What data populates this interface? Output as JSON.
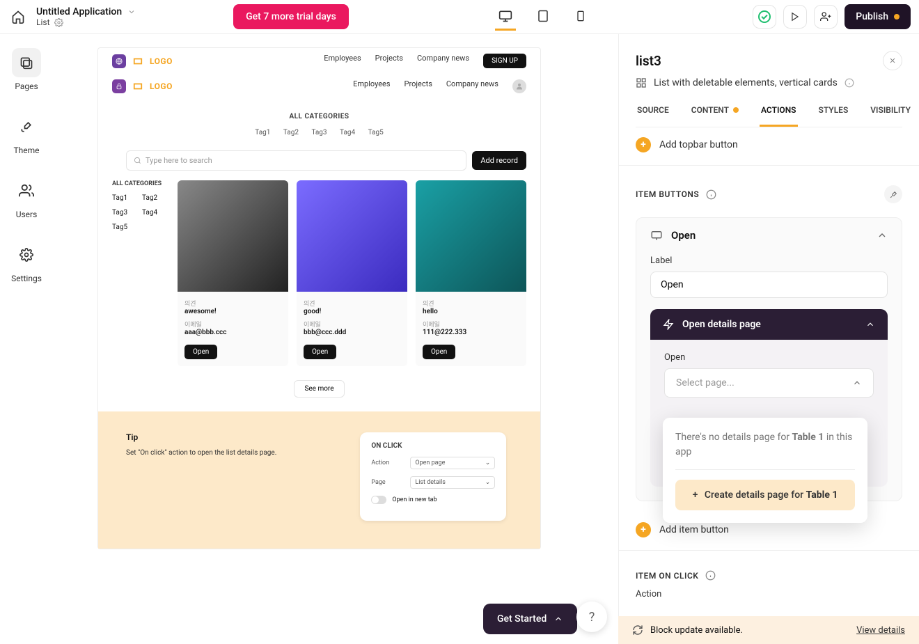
{
  "topbar": {
    "app_title": "Untitled Application",
    "page_label": "List",
    "trial_btn": "Get 7 more trial days",
    "publish_btn": "Publish"
  },
  "leftrail": {
    "pages": "Pages",
    "theme": "Theme",
    "users": "Users",
    "settings": "Settings"
  },
  "canvas": {
    "logo": "LOGO",
    "nav": {
      "employees": "Employees",
      "projects": "Projects",
      "news": "Company news",
      "signup": "SIGN UP"
    },
    "allcat": "ALL CATEGORIES",
    "tags": {
      "t1": "Tag1",
      "t2": "Tag2",
      "t3": "Tag3",
      "t4": "Tag4",
      "t5": "Tag5"
    },
    "search_ph": "Type here to search",
    "addrec": "Add record",
    "side_allcat": "ALL CATEGORIES",
    "cards": [
      {
        "l1": "의견",
        "v1": "awesome!",
        "l2": "이메일",
        "v2": "aaa@bbb.ccc",
        "open": "Open"
      },
      {
        "l1": "의견",
        "v1": "good!",
        "l2": "이메일",
        "v2": "bbb@ccc.ddd",
        "open": "Open"
      },
      {
        "l1": "의견",
        "v1": "hello",
        "l2": "이메일",
        "v2": "111@222.333",
        "open": "Open"
      }
    ],
    "seemore": "See more",
    "tip": {
      "title": "Tip",
      "desc": "Set \"On click\" action to open the list details page.",
      "panel_title": "ON CLICK",
      "row_action": "Action",
      "row_action_val": "Open page",
      "row_page": "Page",
      "row_page_val": "List details",
      "row_newtab": "Open in new tab"
    }
  },
  "panel": {
    "title": "list3",
    "subtitle": "List with deletable elements, vertical cards",
    "tabs": {
      "source": "SOURCE",
      "content": "CONTENT",
      "actions": "ACTIONS",
      "styles": "STYLES",
      "visibility": "VISIBILITY"
    },
    "add_topbar": "Add topbar button",
    "section_item_buttons": "ITEM BUTTONS",
    "open_card_title": "Open",
    "label_label": "Label",
    "label_value": "Open",
    "open_details_title": "Open details page",
    "open_label": "Open",
    "select_placeholder": "Select page...",
    "add_item_button": "Add item button",
    "item_onclick": "ITEM ON CLICK",
    "action_label": "Action",
    "dropdown": {
      "msg_a": "There's no details page for ",
      "msg_b": "Table 1",
      "msg_c": " in this app",
      "create_a": "Create details page for ",
      "create_b": "Table 1"
    }
  },
  "notice": {
    "text": "Block update available.",
    "link": "View details"
  },
  "getstarted": "Get Started"
}
